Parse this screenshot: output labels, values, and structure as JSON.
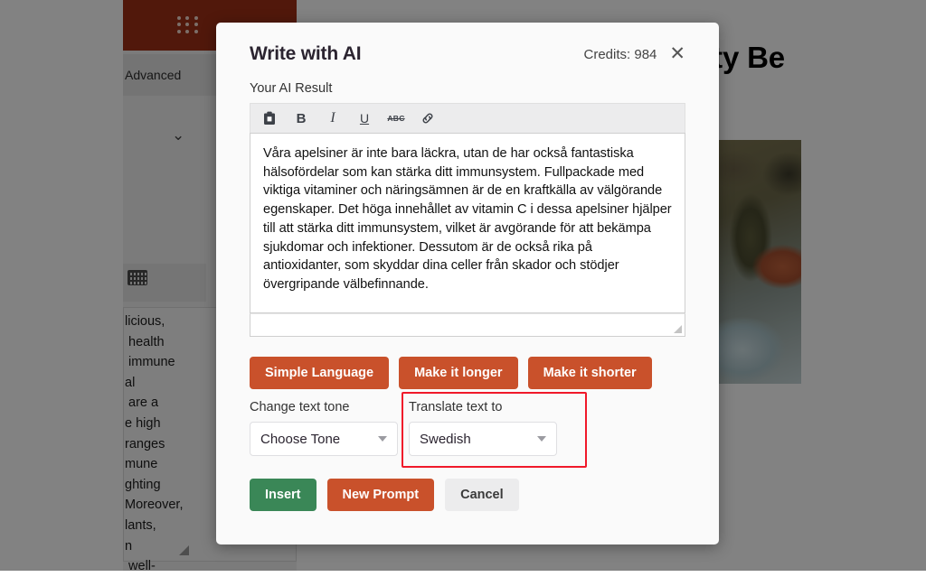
{
  "background": {
    "panel_header_icon": "grid-dots-icon",
    "tab_label": "Advanced",
    "collapse_chevron": "⌄",
    "keyboard_icon": "keyboard-icon",
    "source_text": "licious,\n health\n immune\nal\n are a\ne high\nranges\nmune\nghting\nMoreover,\nlants,\nn\n well-",
    "page_title": "sty Be",
    "photo_alt": "orange-tree-photo"
  },
  "modal": {
    "title": "Write with AI",
    "credits": "Credits: 984",
    "close_icon": "✕",
    "result_label": "Your AI Result",
    "toolbar": {
      "paste_icon": "paste-icon",
      "bold_label": "B",
      "italic_label": "I",
      "underline_label": "U",
      "strikethrough_label": "ABC",
      "link_icon": "link-icon"
    },
    "result_text": "Våra apelsiner är inte bara läckra, utan de har också fantastiska hälsofördelar som kan stärka ditt immunsystem. Fullpackade med viktiga vitaminer och näringsämnen är de en kraftkälla av välgörande egenskaper. Det höga innehållet av vitamin C i dessa apelsiner hjälper till att stärka ditt immunsystem, vilket är avgörande för att bekämpa sjukdomar och infektioner. Dessutom är de också rika på antioxidanter, som skyddar dina celler från skador och stödjer övergripande välbefinnande.",
    "actions": {
      "simple_language": "Simple Language",
      "make_longer": "Make it longer",
      "make_shorter": "Make it shorter"
    },
    "tone": {
      "label": "Change text tone",
      "value": "Choose Tone"
    },
    "translate": {
      "label": "Translate text to",
      "value": "Swedish"
    },
    "footer": {
      "insert": "Insert",
      "new_prompt": "New Prompt",
      "cancel": "Cancel"
    }
  },
  "colors": {
    "accent_orange": "#c9512b",
    "insert_green": "#3a8757",
    "highlight_red": "#f0192a",
    "panel_header": "#a03016"
  }
}
